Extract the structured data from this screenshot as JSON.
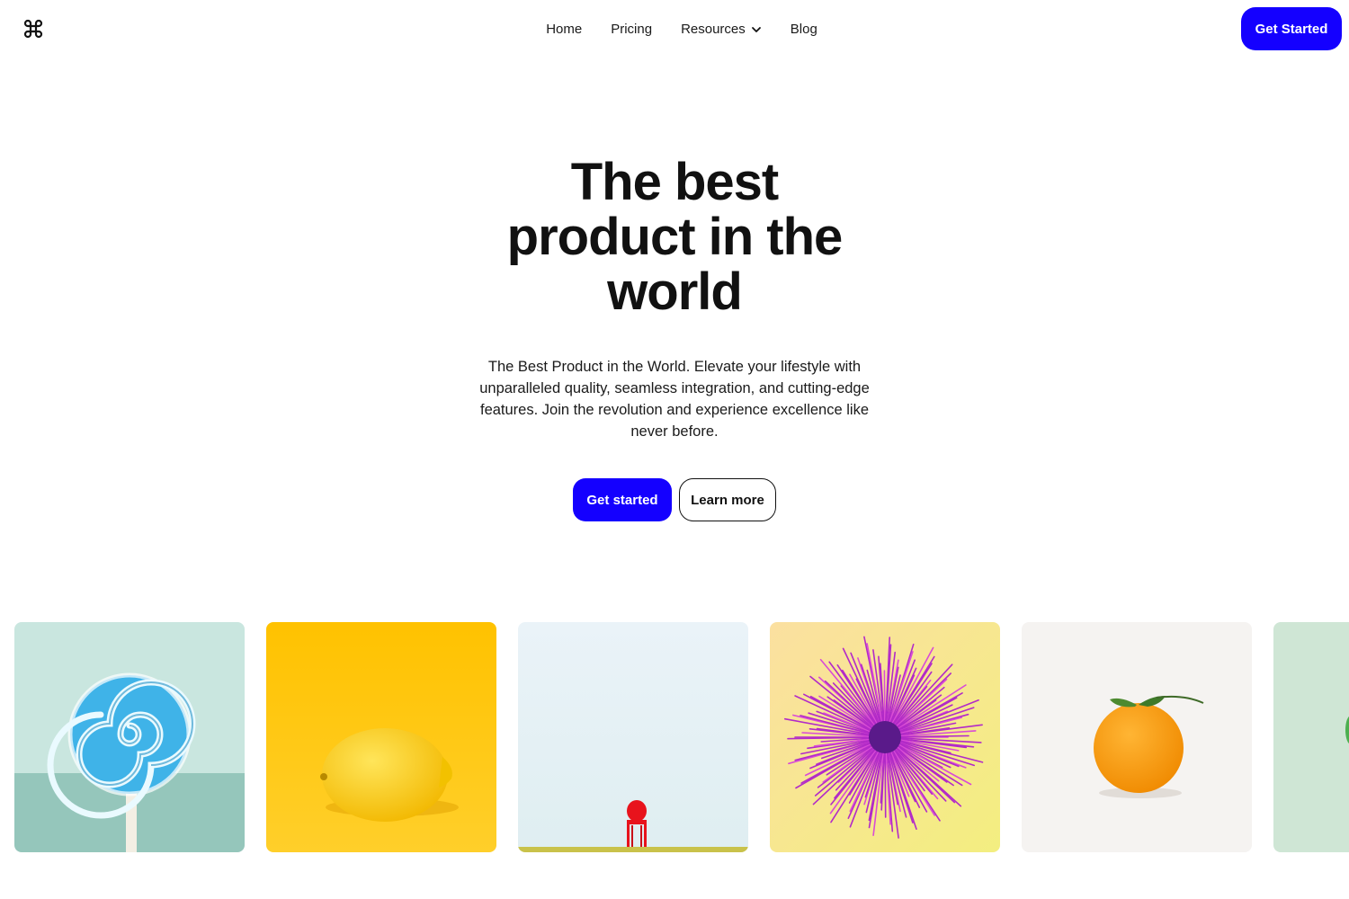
{
  "nav": {
    "logo_icon": "command-icon",
    "links": [
      "Home",
      "Pricing",
      "Resources",
      "Blog"
    ],
    "cta_label": "Get Started"
  },
  "hero": {
    "title_line1": "The best",
    "title_line2": "product in the",
    "title_line3": "world",
    "subtitle": "The Best Product in the World. Elevate your lifestyle with unparalleled quality, seamless integration, and cutting-edge features. Join the revolution and experience excellence like never before.",
    "primary_label": "Get started",
    "secondary_label": "Learn more"
  },
  "gallery": {
    "items": [
      {
        "subject": "lollipop"
      },
      {
        "subject": "lemon"
      },
      {
        "subject": "red-chair"
      },
      {
        "subject": "purple-spiky-ball"
      },
      {
        "subject": "orange"
      },
      {
        "subject": "green-partial"
      }
    ]
  },
  "colors": {
    "accent": "#1400ff",
    "text": "#111111",
    "background": "#ffffff"
  }
}
